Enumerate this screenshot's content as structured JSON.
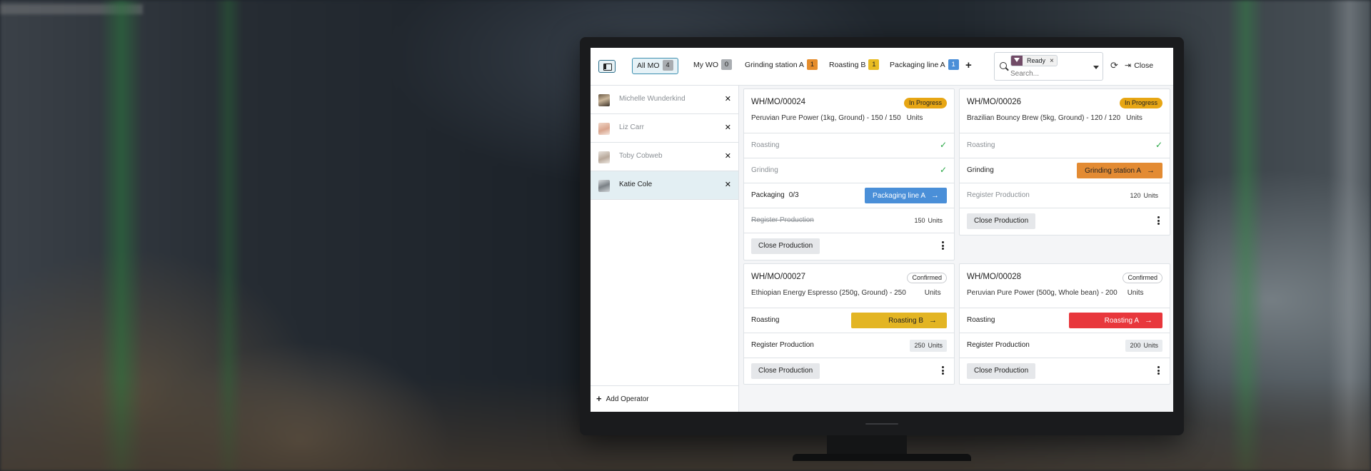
{
  "colors": {
    "accent": "#3c8fb0",
    "status_in_progress": "#e7a614",
    "btn_packaging": "#4a8fd8",
    "btn_grinding": "#e38b33",
    "btn_roasting_b": "#e3b523",
    "btn_roasting_a": "#e8373c",
    "badge_orange": "#e58d2d",
    "badge_yellow": "#e8bb22",
    "badge_blue": "#4a8fd8",
    "badge_grey": "#a9adb1"
  },
  "topbar": {
    "tabs": [
      {
        "label": "All MO",
        "count": "4",
        "badge_color": "#a9adb1"
      },
      {
        "label": "My WO",
        "count": "0",
        "badge_color": "#a9adb1"
      },
      {
        "label": "Grinding station A",
        "count": "1",
        "badge_color": "#e58d2d"
      },
      {
        "label": "Roasting B",
        "count": "1",
        "badge_color": "#e8bb22"
      },
      {
        "label": "Packaging line A",
        "count": "1",
        "badge_color": "#4a8fd8"
      }
    ],
    "search": {
      "facet": "Ready",
      "placeholder": "Search..."
    },
    "close_label": "Close"
  },
  "operators": {
    "items": [
      {
        "name": "Michelle Wunderkind"
      },
      {
        "name": "Liz Carr"
      },
      {
        "name": "Toby Cobweb"
      },
      {
        "name": "Katie Cole"
      }
    ],
    "add_label": "Add Operator"
  },
  "cards": [
    {
      "name": "WH/MO/00024",
      "status": "In Progress",
      "product": "Peruvian Pure Power (1kg, Ground) - 150 / 150",
      "unit": "Units",
      "rows": [
        {
          "label": "Roasting"
        },
        {
          "label": "Grinding"
        },
        {
          "label": "Packaging",
          "count": "0/3",
          "button": "Packaging line A"
        },
        {
          "label": "Register Production",
          "qty": "150",
          "qty_unit": "Units"
        }
      ],
      "close_label": "Close Production"
    },
    {
      "name": "WH/MO/00026",
      "status": "In Progress",
      "product": "Brazilian Bouncy Brew (5kg, Ground) - 120 / 120",
      "unit": "Units",
      "rows": [
        {
          "label": "Roasting"
        },
        {
          "label": "Grinding",
          "button": "Grinding station A"
        },
        {
          "label": "Register Production",
          "qty": "120",
          "qty_unit": "Units"
        }
      ],
      "close_label": "Close Production"
    },
    {
      "name": "WH/MO/00027",
      "status": "Confirmed",
      "product": "Ethiopian Energy Espresso (250g, Ground) - 250",
      "unit": "Units",
      "rows": [
        {
          "label": "Roasting",
          "button": "Roasting B"
        },
        {
          "label": "Register Production",
          "qty": "250",
          "qty_unit": "Units"
        }
      ],
      "close_label": "Close Production"
    },
    {
      "name": "WH/MO/00028",
      "status": "Confirmed",
      "product": "Peruvian Pure Power (500g, Whole bean) - 200",
      "unit": "Units",
      "rows": [
        {
          "label": "Roasting",
          "button": "Roasting A"
        },
        {
          "label": "Register Production",
          "qty": "200",
          "qty_unit": "Units"
        }
      ],
      "close_label": "Close Production"
    }
  ]
}
